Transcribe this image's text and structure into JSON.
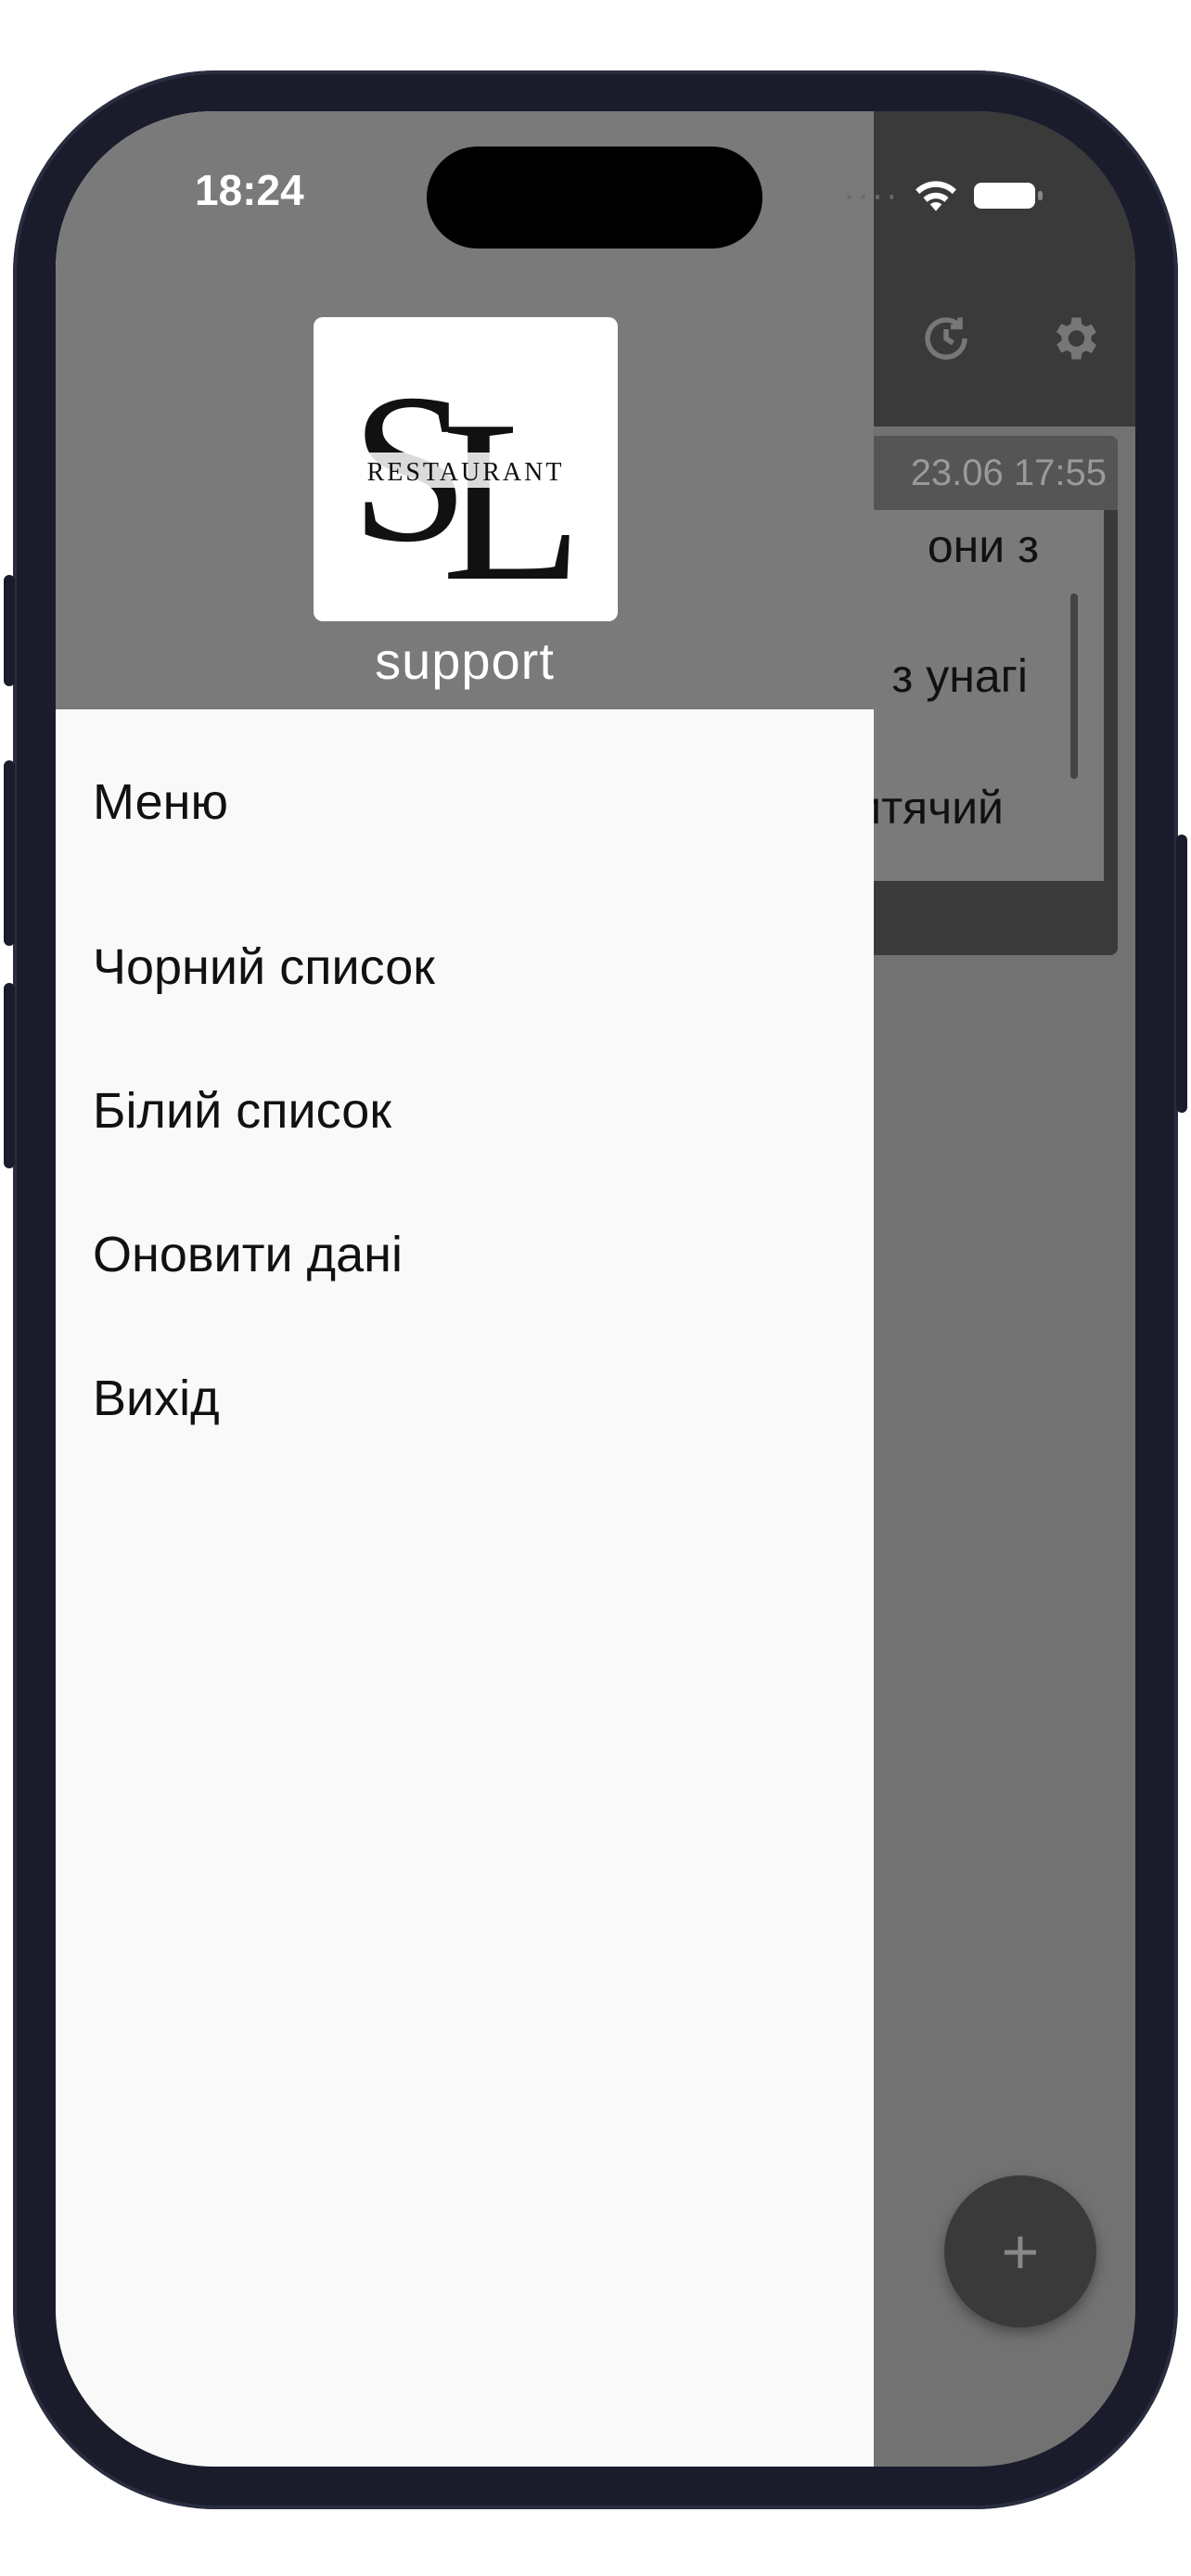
{
  "status_bar": {
    "time": "18:24"
  },
  "background_app": {
    "date": "23.06 17:55",
    "lines": [
      "они з",
      "з унагі",
      "итячий"
    ],
    "fab_label": "+"
  },
  "drawer": {
    "logo_text": "RESTAURANT",
    "logo_letters": "SL",
    "logo_subtitle": "support",
    "menu": [
      {
        "label": "Меню"
      },
      {
        "label": "Чорний список"
      },
      {
        "label": "Білий список"
      },
      {
        "label": "Оновити дані"
      },
      {
        "label": "Вихід"
      }
    ]
  },
  "colors": {
    "drawer_bg": "#f9f9f9",
    "drawer_header": "#7a7a7a",
    "overlay_dark": "#3a3a3a",
    "text": "#111111"
  }
}
